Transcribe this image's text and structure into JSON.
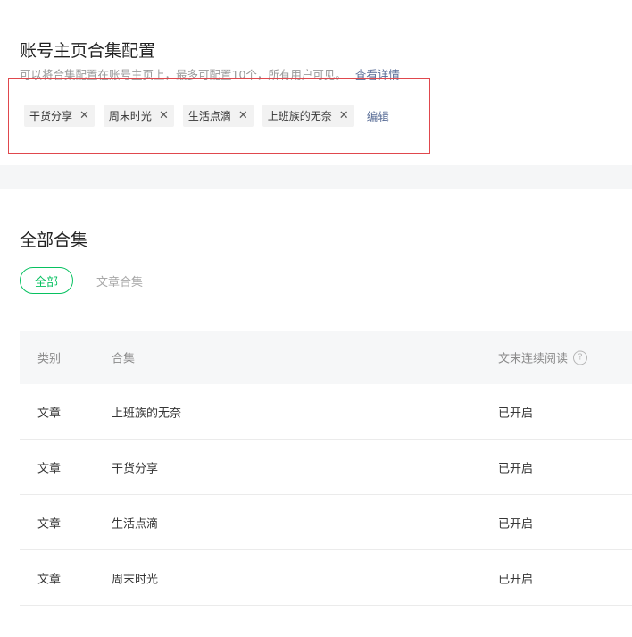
{
  "config": {
    "title": "账号主页合集配置",
    "description": "可以将合集配置在账号主页上，最多可配置10个，所有用户可见。",
    "detail_link": "查看详情",
    "tags": [
      "干货分享",
      "周末时光",
      "生活点滴",
      "上班族的无奈"
    ],
    "edit_label": "编辑"
  },
  "all": {
    "title": "全部合集",
    "filters": [
      "全部",
      "文章合集"
    ],
    "active_filter": "全部",
    "table": {
      "headers": [
        "类别",
        "合集",
        "文末连续阅读"
      ],
      "rows": [
        {
          "type": "文章",
          "name": "上班族的无奈",
          "status": "已开启"
        },
        {
          "type": "文章",
          "name": "干货分享",
          "status": "已开启"
        },
        {
          "type": "文章",
          "name": "生活点滴",
          "status": "已开启"
        },
        {
          "type": "文章",
          "name": "周末时光",
          "status": "已开启"
        }
      ]
    }
  },
  "colors": {
    "accent_green": "#07c160",
    "link_blue": "#576b95",
    "highlight_red": "#e0484d"
  },
  "icons": {
    "tag_remove": "close-icon",
    "header_help": "question-circle-icon"
  }
}
